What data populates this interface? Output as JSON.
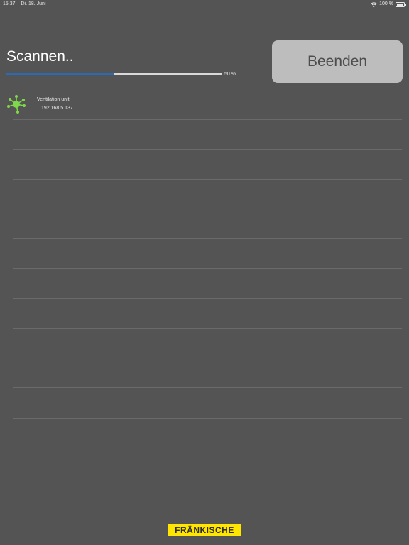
{
  "status_bar": {
    "time": "15:37",
    "date": "Di. 18. Juni",
    "battery": "100 %"
  },
  "scan": {
    "title": "Scannen..",
    "progress_label": "50 %",
    "progress": 0.5
  },
  "finish_button": {
    "label": "Beenden"
  },
  "devices": [
    {
      "name": "Ventilation unit",
      "ip": "192.168.5.137"
    }
  ],
  "logo": {
    "text": "FRÄNKISCHE"
  },
  "colors": {
    "background": "#545454",
    "progress": "#2d6ab4",
    "device_icon": "#7dd84a",
    "logo_bg": "#ffe500"
  },
  "icons": {
    "device": "network-hub-icon",
    "wifi": "wifi-icon",
    "battery": "battery-icon"
  }
}
